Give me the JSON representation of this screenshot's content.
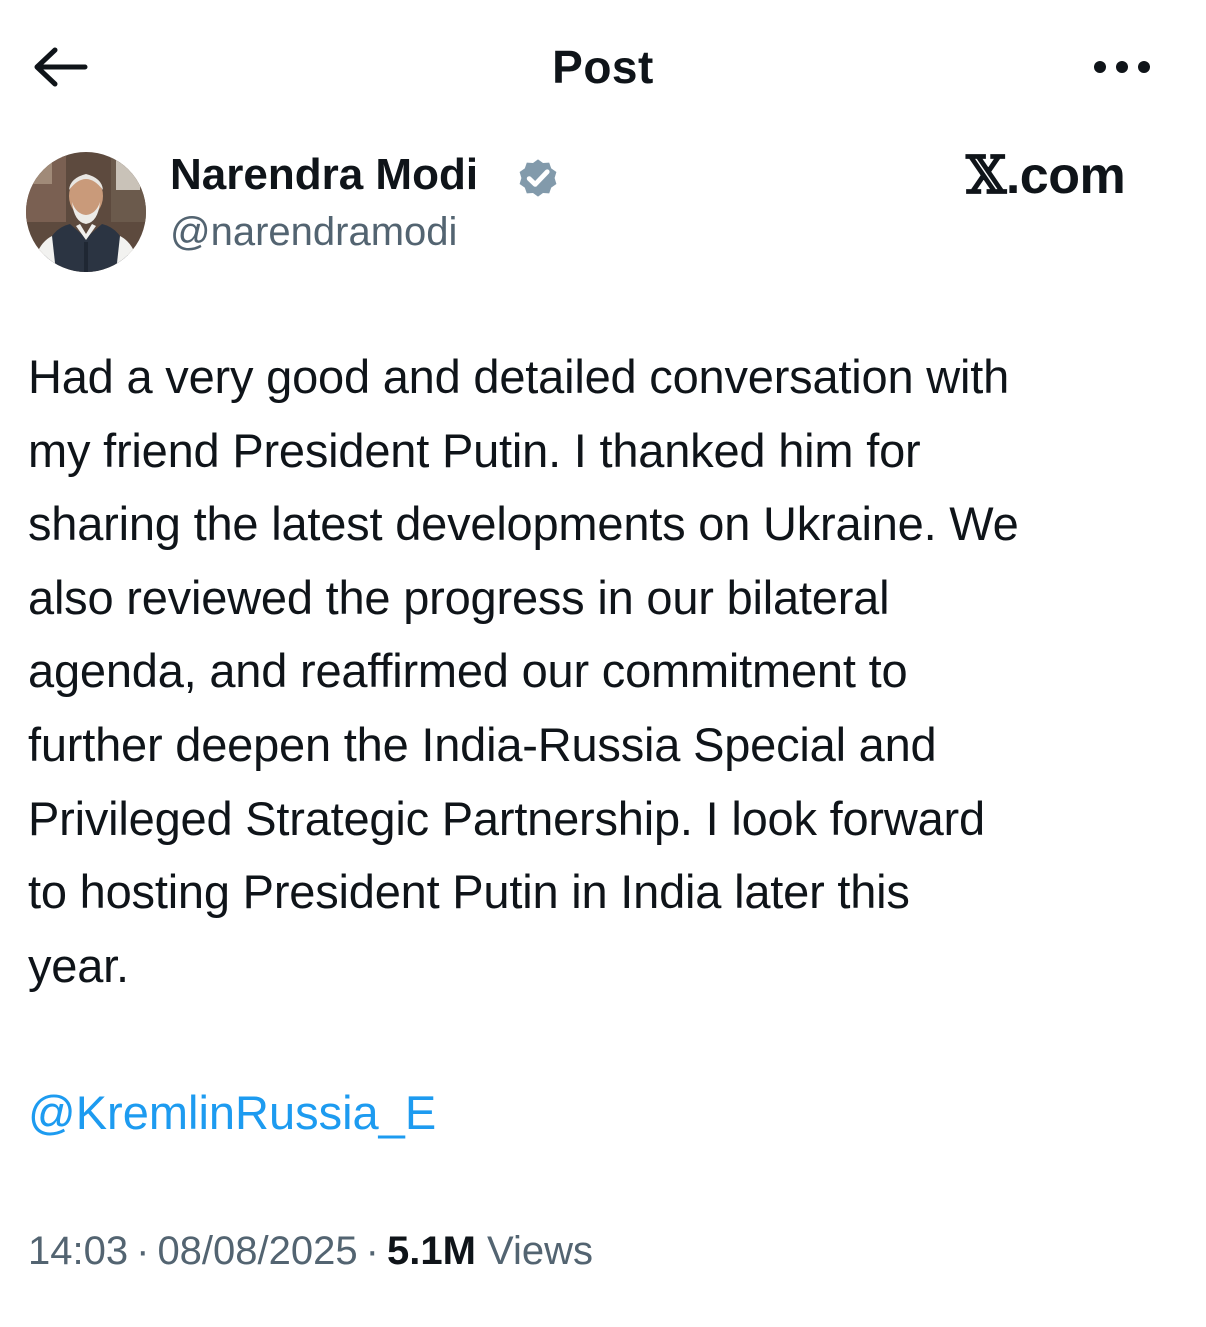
{
  "header": {
    "title": "Post",
    "back_icon": "arrow-left-icon",
    "more_icon": "more-horizontal-icon"
  },
  "author": {
    "name": "Narendra Modi",
    "handle": "@narendramodi",
    "verified_icon": "verified-badge-icon",
    "verified_color": "#829aab"
  },
  "watermark": {
    "glyph": "𝕏",
    "suffix": ".com"
  },
  "post": {
    "text": "Had a very good and detailed conversation with\nmy friend President Putin. I thanked him for\nsharing the latest developments on Ukraine. We\nalso reviewed the progress in our bilateral\nagenda, and reaffirmed our commitment to\nfurther deepen the India-Russia Special and\nPrivileged Strategic Partnership. I look forward\nto hosting President Putin in India later this\nyear.",
    "mention": "@KremlinRussia_E",
    "time": "14:03",
    "date": "08/08/2025",
    "separator": "·",
    "views_count": "5.1M",
    "views_label": "Views"
  },
  "colors": {
    "text": "#0f1419",
    "secondary": "#536471",
    "link": "#1d9bf0"
  }
}
